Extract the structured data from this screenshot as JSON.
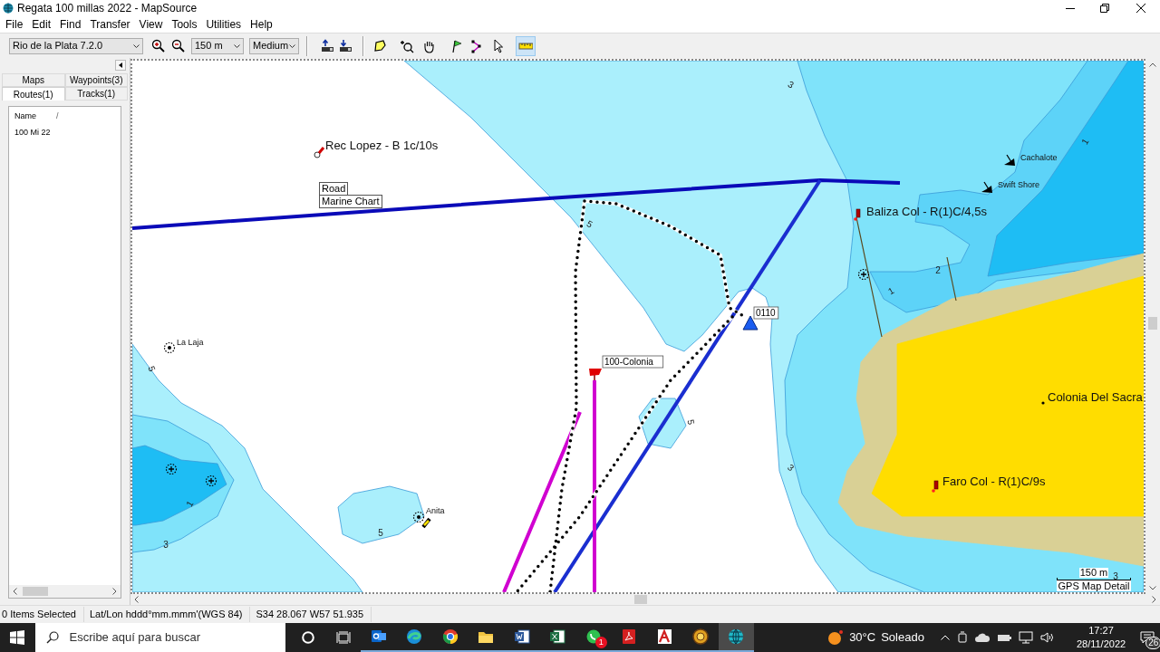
{
  "window": {
    "title": "Regata 100 millas 2022 - MapSource"
  },
  "menu": [
    "File",
    "Edit",
    "Find",
    "Transfer",
    "View",
    "Tools",
    "Utilities",
    "Help"
  ],
  "toolbar": {
    "map_product": "Rio de la Plata 7.2.0",
    "scale": "150 m",
    "detail": "Medium",
    "tools": [
      {
        "kind": "map",
        "selected": false
      },
      {
        "kind": "zoom",
        "selected": false
      },
      {
        "kind": "pan",
        "selected": false
      },
      {
        "kind": "waypoint",
        "selected": false
      },
      {
        "kind": "route",
        "selected": false
      },
      {
        "kind": "select",
        "selected": false
      },
      {
        "kind": "measure",
        "selected": true
      }
    ]
  },
  "sidebar": {
    "tabs": [
      {
        "label": "Maps",
        "selected": false
      },
      {
        "label": "Waypoints(3)",
        "selected": false
      },
      {
        "label": "Routes(1)",
        "selected": true
      },
      {
        "label": "Tracks(1)",
        "selected": false
      }
    ],
    "list": {
      "column": "Name",
      "sort_mark": "/",
      "rows": [
        "100 Mi 22"
      ]
    }
  },
  "map": {
    "labels": [
      {
        "kind": "buoy",
        "text": "Rec Lopez - B 1c/10s"
      },
      {
        "kind": "wreck",
        "text": "Cachalote"
      },
      {
        "kind": "wreck",
        "text": "Swift Shore"
      },
      {
        "kind": "light",
        "text": "Baliza Col - R(1)C/4,5s"
      },
      {
        "kind": "marker",
        "text": "0110"
      },
      {
        "kind": "rock",
        "text": "La Laja"
      },
      {
        "kind": "flag",
        "text": "100-Colonia"
      },
      {
        "kind": "city",
        "text": "Colonia Del Sacra"
      },
      {
        "kind": "light",
        "text": "Faro Col - R(1)C/9s"
      },
      {
        "kind": "rock",
        "text": "Anita"
      }
    ],
    "depths": [
      "3",
      "1",
      "5",
      "2",
      "1",
      "5",
      "1",
      "3",
      "5",
      "5",
      "3",
      "3"
    ],
    "tooltip": [
      "Road",
      "Marine Chart"
    ],
    "scale": {
      "distance": "150 m",
      "detail": "GPS Map Detail"
    }
  },
  "status_bar": [
    "0 Items Selected",
    "Lat/Lon hddd°mm.mmm'(WGS 84)",
    "S34 28.067 W57 51.935"
  ],
  "taskbar": {
    "search_placeholder": "Escribe aquí para buscar",
    "apps": [
      {
        "kind": "mail",
        "selected": false
      },
      {
        "kind": "edge",
        "selected": false
      },
      {
        "kind": "chrome",
        "selected": false
      },
      {
        "kind": "folder",
        "selected": false
      },
      {
        "kind": "word",
        "selected": false
      },
      {
        "kind": "excel",
        "selected": false
      },
      {
        "kind": "chat",
        "selected": false,
        "badge": "1"
      },
      {
        "kind": "pdf",
        "selected": false
      },
      {
        "kind": "cad",
        "selected": false
      },
      {
        "kind": "compass",
        "selected": false
      },
      {
        "kind": "globe",
        "selected": true
      }
    ],
    "temperature": "30°C",
    "weather": "Soleado",
    "time": "17:27",
    "date": "28/11/2022",
    "notifications": "26"
  }
}
